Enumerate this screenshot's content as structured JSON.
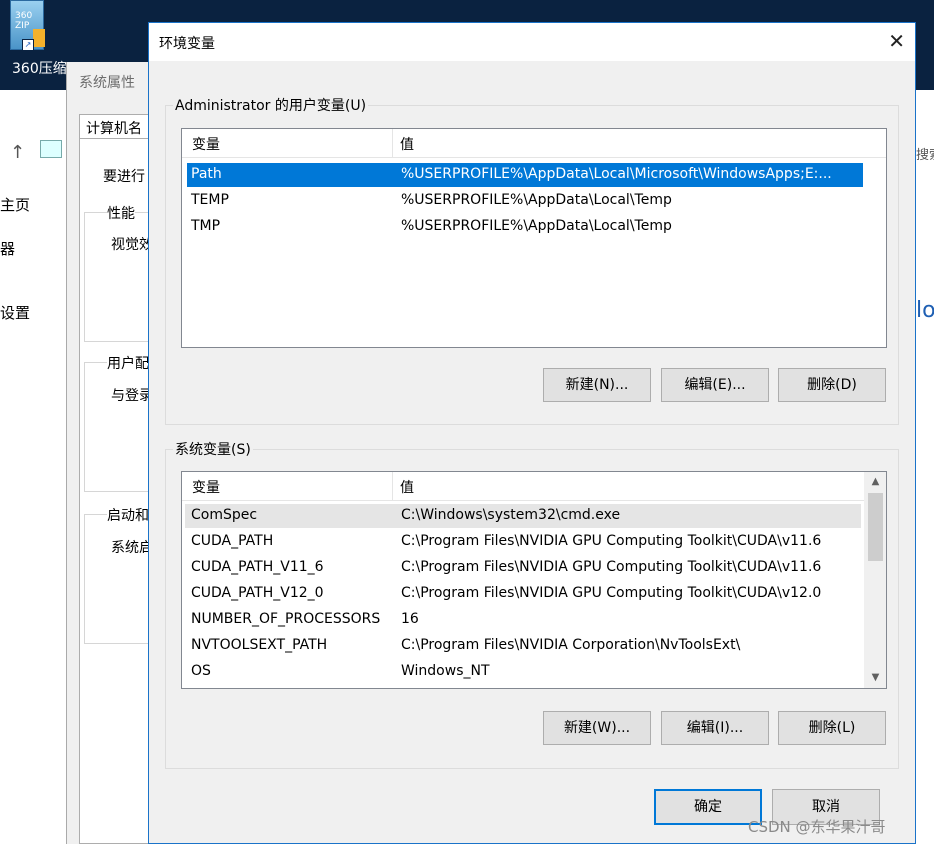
{
  "desktop": {
    "icon_label": "360压缩",
    "icon_text": "360\nZIP"
  },
  "explorer": {
    "items": [
      "主页",
      "器",
      "设置"
    ],
    "right_text": "搜索",
    "right_big": "lo"
  },
  "sysprop": {
    "title": "系统属性",
    "tab": "计算机名",
    "text1": "要进行",
    "group1": "性能",
    "group1_text": "视觉效",
    "group2": "用户配",
    "group2_text": "与登录",
    "group3": "启动和",
    "group3_text": "系统启"
  },
  "dialog": {
    "title": "环境变量",
    "user_group": {
      "label": "Administrator 的用户变量(U)",
      "col_var": "变量",
      "col_val": "值",
      "rows": [
        {
          "name": "Path",
          "value": "%USERPROFILE%\\AppData\\Local\\Microsoft\\WindowsApps;E:..."
        },
        {
          "name": "TEMP",
          "value": "%USERPROFILE%\\AppData\\Local\\Temp"
        },
        {
          "name": "TMP",
          "value": "%USERPROFILE%\\AppData\\Local\\Temp"
        }
      ],
      "btn_new": "新建(N)...",
      "btn_edit": "编辑(E)...",
      "btn_delete": "删除(D)"
    },
    "system_group": {
      "label": "系统变量(S)",
      "col_var": "变量",
      "col_val": "值",
      "rows": [
        {
          "name": "ComSpec",
          "value": "C:\\Windows\\system32\\cmd.exe"
        },
        {
          "name": "CUDA_PATH",
          "value": "C:\\Program Files\\NVIDIA GPU Computing Toolkit\\CUDA\\v11.6"
        },
        {
          "name": "CUDA_PATH_V11_6",
          "value": "C:\\Program Files\\NVIDIA GPU Computing Toolkit\\CUDA\\v11.6"
        },
        {
          "name": "CUDA_PATH_V12_0",
          "value": "C:\\Program Files\\NVIDIA GPU Computing Toolkit\\CUDA\\v12.0"
        },
        {
          "name": "NUMBER_OF_PROCESSORS",
          "value": "16"
        },
        {
          "name": "NVTOOLSEXT_PATH",
          "value": "C:\\Program Files\\NVIDIA Corporation\\NvToolsExt\\"
        },
        {
          "name": "OS",
          "value": "Windows_NT"
        }
      ],
      "btn_new": "新建(W)...",
      "btn_edit": "编辑(I)...",
      "btn_delete": "删除(L)"
    },
    "btn_ok": "确定",
    "btn_cancel": "取消"
  },
  "watermark": "CSDN @东华果汁哥",
  "colors": {
    "selection": "#0078d7",
    "dialog_border": "#1a73c9",
    "desktop": "#0a2240"
  }
}
